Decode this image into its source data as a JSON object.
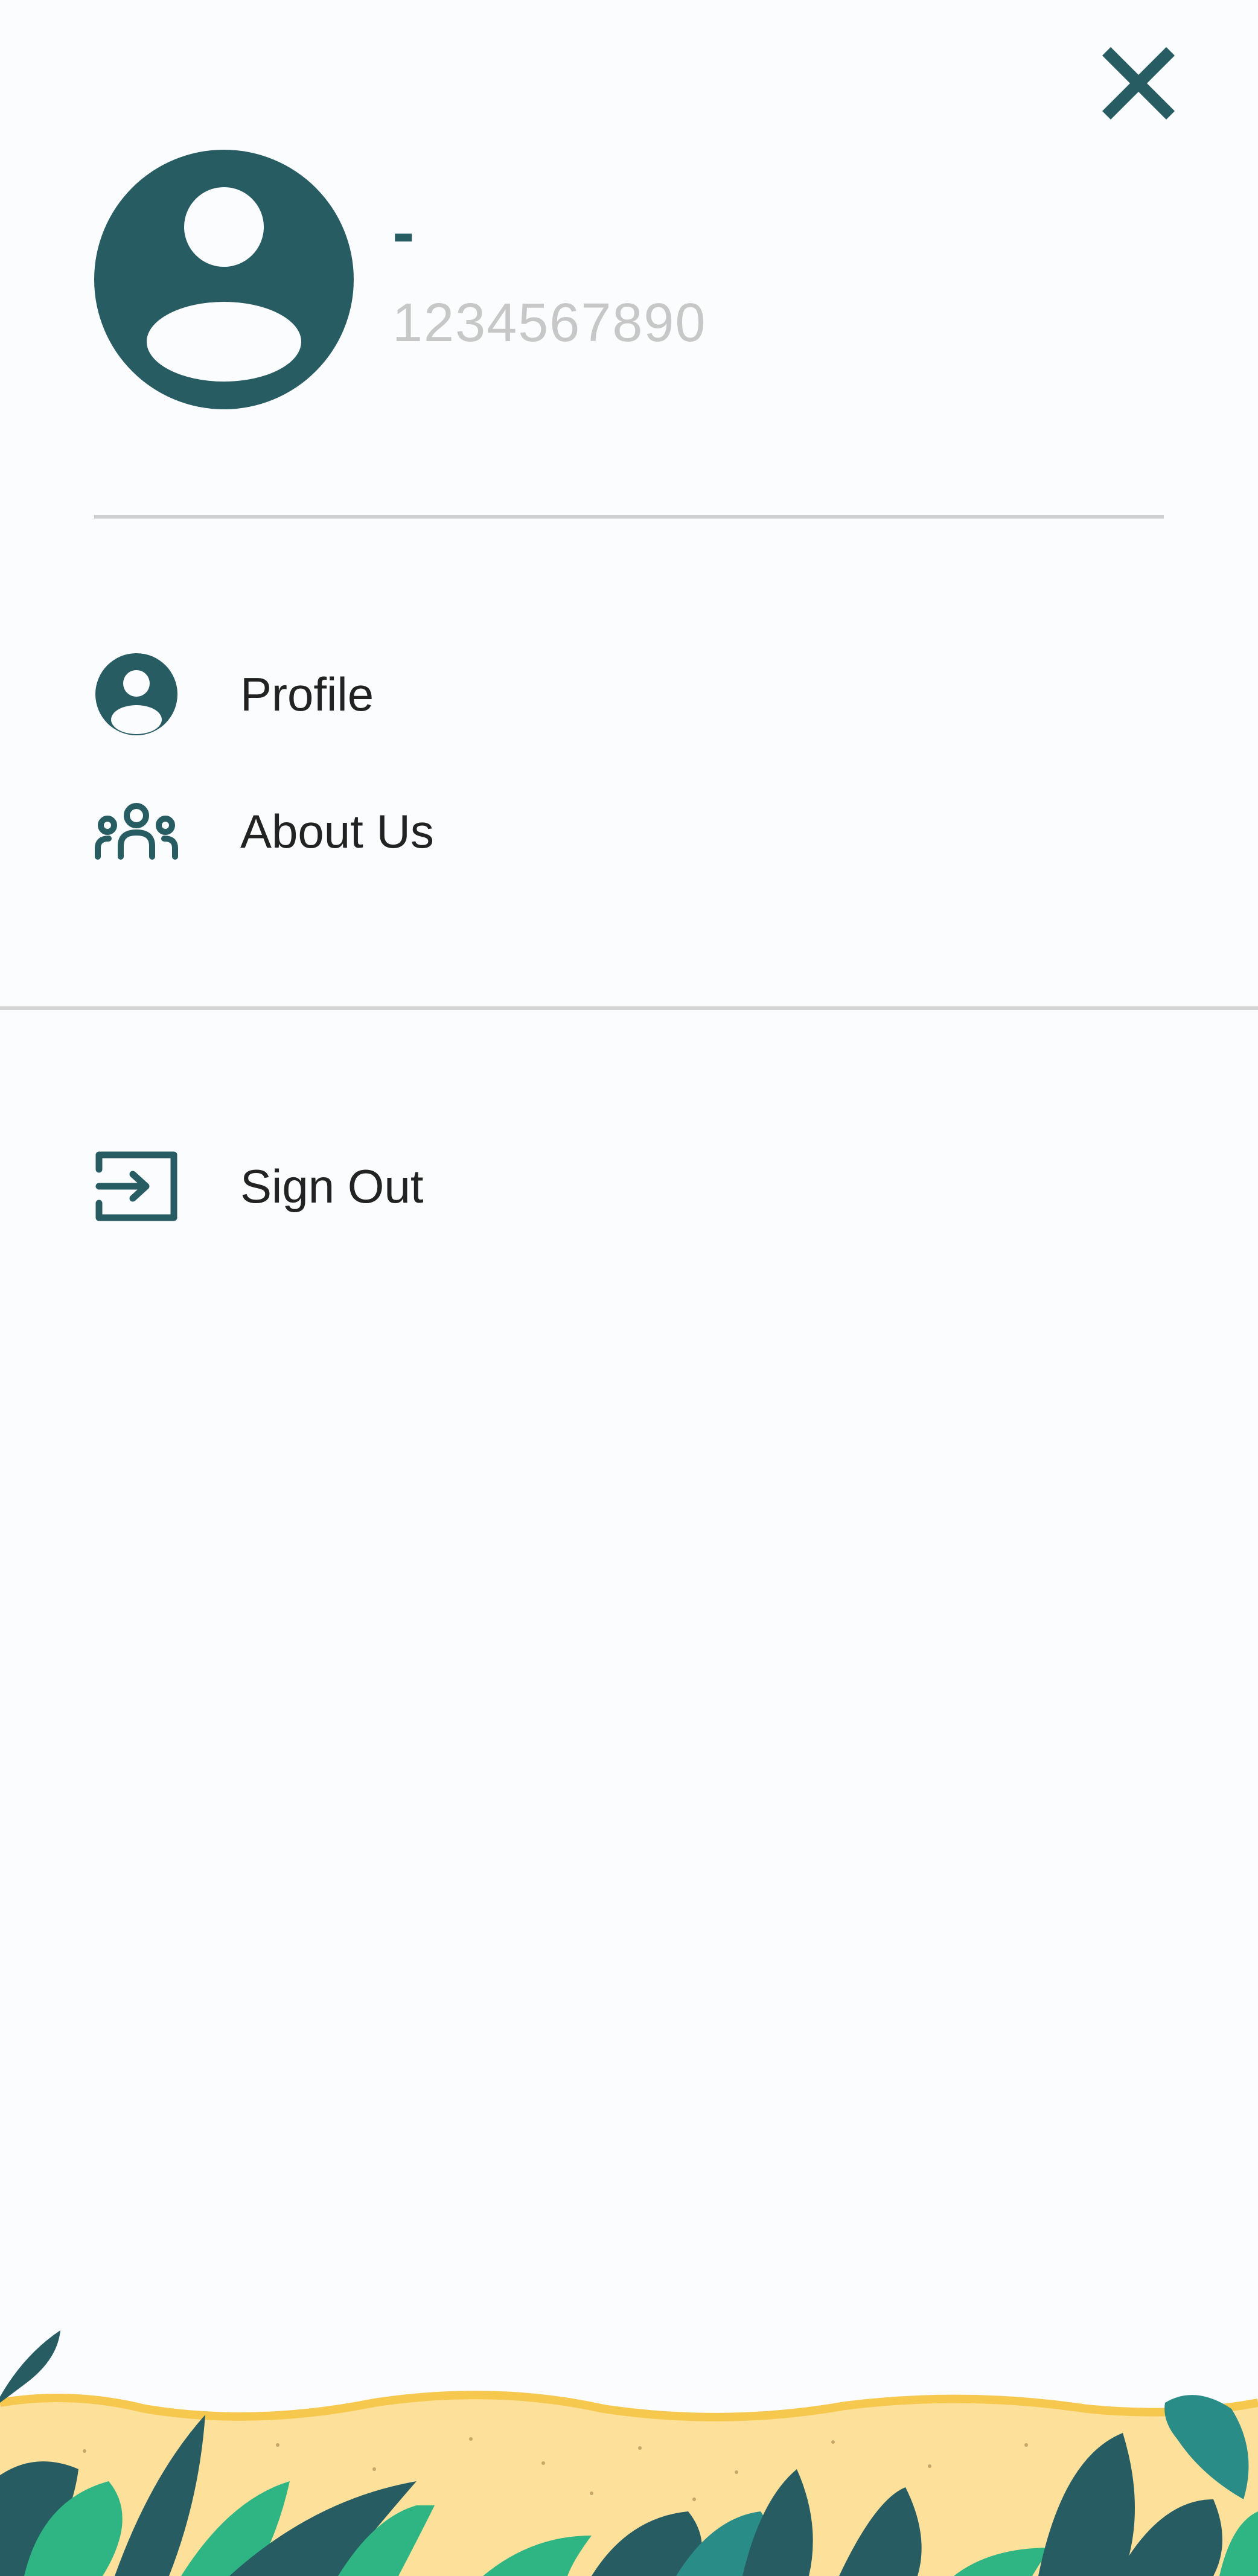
{
  "drawer": {
    "close_icon": "close-icon",
    "user": {
      "name": "-",
      "phone": "1234567890",
      "avatar_icon": "user-avatar-icon"
    },
    "menu": [
      {
        "label": "Profile",
        "icon": "user-circle-icon"
      },
      {
        "label": "About Us",
        "icon": "users-group-icon"
      }
    ],
    "sign_out": {
      "label": "Sign Out",
      "icon": "sign-out-icon"
    }
  },
  "colors": {
    "accent": "#285c63",
    "background": "#fbfcfe",
    "divider": "#cfcfcf",
    "secondary_text": "#c7c7c7",
    "sand": "#fde09a",
    "leaf_green": "#2fb583"
  }
}
